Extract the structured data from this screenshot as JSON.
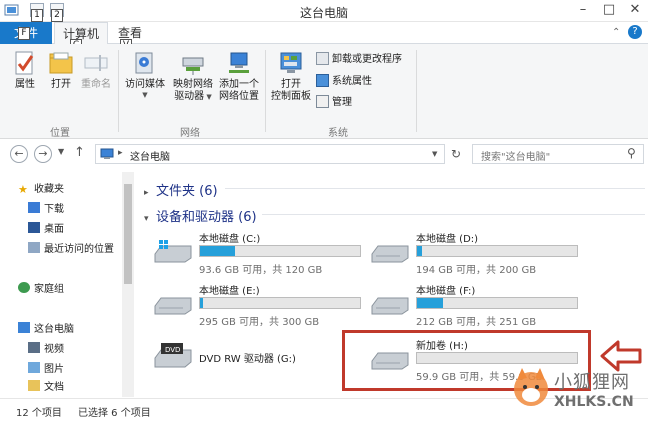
{
  "window": {
    "title": "这台电脑",
    "keytips": [
      "1",
      "2",
      "F",
      "C",
      "V"
    ],
    "controls": [
      "minimize",
      "maximize",
      "close"
    ]
  },
  "ribbon": {
    "tabs": [
      {
        "label": "文件"
      },
      {
        "label": "计算机"
      },
      {
        "label": "查看"
      }
    ],
    "groups": {
      "location": {
        "label": "位置",
        "buttons": [
          {
            "label": "属性",
            "icon": "checkmark-page-icon"
          },
          {
            "label": "打开",
            "icon": "folder-open-icon"
          },
          {
            "label": "重命名",
            "icon": "rename-icon",
            "disabled": true
          }
        ]
      },
      "network": {
        "label": "网络",
        "buttons": [
          {
            "label": "访问媒体",
            "icon": "media-icon"
          },
          {
            "label": "映射网络",
            "label2": "驱动器",
            "icon": "map-drive-icon"
          },
          {
            "label": "添加一个",
            "label2": "网络位置",
            "icon": "network-location-icon"
          }
        ]
      },
      "system": {
        "label": "系统",
        "big_button": {
          "label": "打开",
          "label2": "控制面板",
          "icon": "control-panel-icon"
        },
        "small_buttons": [
          {
            "label": "卸载或更改程序",
            "icon": "uninstall-icon"
          },
          {
            "label": "系统属性",
            "icon": "system-properties-icon"
          },
          {
            "label": "管理",
            "icon": "manage-icon"
          }
        ]
      }
    },
    "help_icon": "help-icon",
    "collapse_icon": "chevron-up-icon"
  },
  "navigation": {
    "path": "这台电脑",
    "search_placeholder": "搜索\"这台电脑\"",
    "nav_icons": [
      "back-icon",
      "forward-icon",
      "recent-icon",
      "up-icon",
      "refresh-icon",
      "search-icon"
    ]
  },
  "nav_pane": {
    "items": [
      {
        "label": "收藏夹",
        "icon": "star-icon"
      },
      {
        "label": "下载",
        "icon": "download-folder-icon"
      },
      {
        "label": "桌面",
        "icon": "desktop-icon"
      },
      {
        "label": "最近访问的位置",
        "icon": "recent-places-icon"
      },
      {
        "label": "家庭组",
        "icon": "homegroup-icon"
      },
      {
        "label": "这台电脑",
        "icon": "computer-icon"
      },
      {
        "label": "视频",
        "icon": "video-folder-icon"
      },
      {
        "label": "图片",
        "icon": "pictures-folder-icon"
      },
      {
        "label": "文档",
        "icon": "documents-folder-icon"
      }
    ]
  },
  "content": {
    "folders_header": "文件夹 (6)",
    "devices_header": "设备和驱动器 (6)",
    "drives": [
      {
        "name": "本地磁盘 (C:)",
        "info": "93.6 GB 可用，共 120 GB",
        "used_fraction": 0.22,
        "icon": "windows-drive-icon"
      },
      {
        "name": "本地磁盘 (D:)",
        "info": "194 GB 可用，共 200 GB",
        "used_fraction": 0.03,
        "icon": "hdd-icon"
      },
      {
        "name": "本地磁盘 (E:)",
        "info": "295 GB 可用，共 300 GB",
        "used_fraction": 0.02,
        "icon": "hdd-icon"
      },
      {
        "name": "本地磁盘 (F:)",
        "info": "212 GB 可用，共 251 GB",
        "used_fraction": 0.16,
        "icon": "hdd-icon"
      },
      {
        "name": "DVD RW 驱动器 (G:)",
        "icon": "dvd-drive-icon"
      },
      {
        "name": "新加卷 (H:)",
        "info": "59.9 GB 可用，共 59.9 GB",
        "used_fraction": 0.0,
        "icon": "hdd-icon"
      }
    ]
  },
  "status": {
    "count": "12 个项目",
    "selected": "已选择 6 个项目"
  },
  "annotation": {
    "color": "#c0392b",
    "arrow_icon": "left-arrow-icon"
  },
  "watermark": {
    "cn": "小狐狸网",
    "en": "XHLKS.CN",
    "icon": "fox-logo-icon"
  }
}
